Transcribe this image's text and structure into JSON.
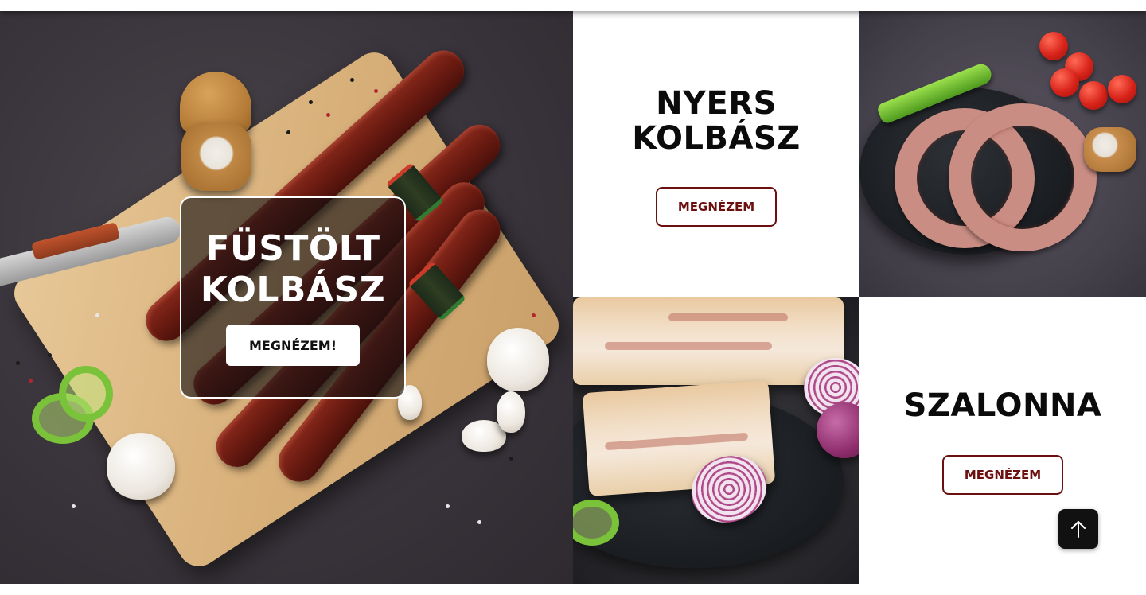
{
  "tiles": {
    "smoked": {
      "title": "FÜSTÖLT KOLBÁSZ",
      "button_label": "MEGNÉZEM!",
      "image_alt": "smoked-sausage-photo"
    },
    "nyers": {
      "title": "NYERS KOLBÁSZ",
      "button_label": "MEGNÉZEM"
    },
    "raw": {
      "image_alt": "raw-sausage-photo"
    },
    "bacon": {
      "image_alt": "bacon-photo"
    },
    "szalonna": {
      "title": "SZALONNA",
      "button_label": "MEGNÉZEM"
    }
  },
  "scroll_top": {
    "icon": "arrow-up-icon"
  },
  "colors": {
    "accent": "#6b0f0f",
    "button_dark": "#111111",
    "text_dark": "#0b0b0b",
    "white": "#ffffff"
  }
}
